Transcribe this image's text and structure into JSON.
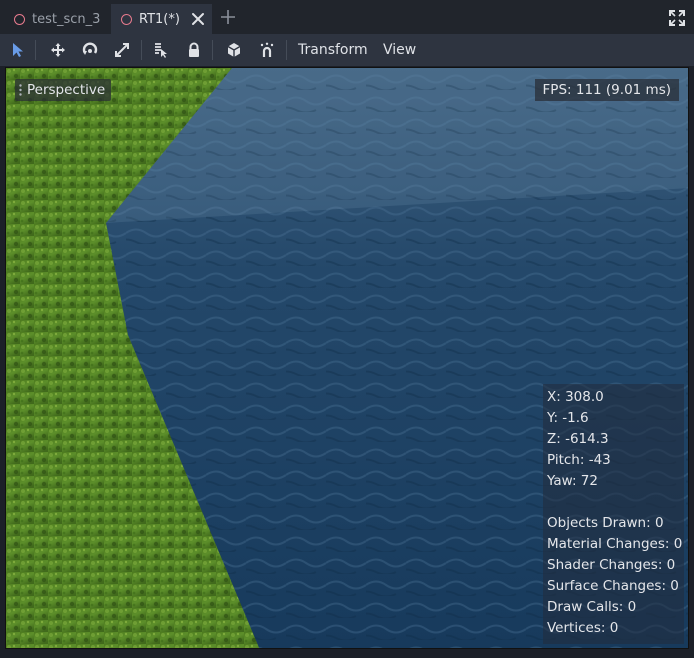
{
  "tabs": [
    {
      "label": "test_scn_3"
    },
    {
      "label": "RT1(*)"
    }
  ],
  "toolbar": {
    "transform_label": "Transform",
    "view_label": "View"
  },
  "viewport": {
    "perspective_label": "Perspective",
    "fps_label": "FPS: 111 (9.01 ms)",
    "stats": {
      "x": "X: 308.0",
      "y": "Y: -1.6",
      "z": "Z: -614.3",
      "pitch": "Pitch: -43",
      "yaw": "Yaw: 72",
      "objects_drawn": "Objects Drawn: 0",
      "material_changes": "Material Changes: 0",
      "shader_changes": "Shader Changes: 0",
      "surface_changes": "Surface Changes: 0",
      "draw_calls": "Draw Calls: 0",
      "vertices": "Vertices: 0"
    }
  },
  "colors": {
    "accent": "#699ce8",
    "scene_icon": "#e87b8e",
    "water": "#1f4466",
    "grass": "#5a8a2a"
  }
}
